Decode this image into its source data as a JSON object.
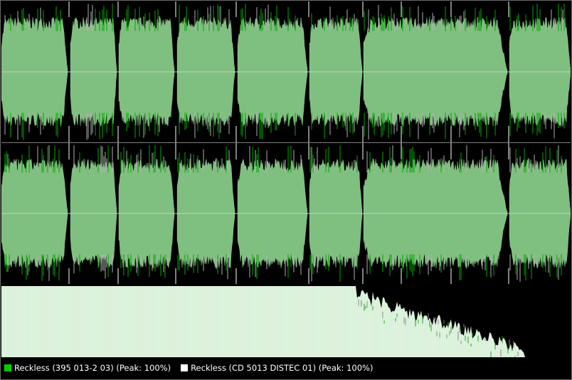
{
  "legend": {
    "items": [
      {
        "label": "Reckless (395 013-2 03) (Peak: 100%)",
        "color": "#00cc00"
      },
      {
        "label": "Reckless (CD 5013 DISTEC 01) (Peak: 100%)",
        "color": "#ffffff"
      }
    ]
  },
  "colors": {
    "background": "#000000",
    "wave_fill": "#7fbf7f",
    "wave_peak_a": "#00a800",
    "wave_peak_b": "#b0b0b0",
    "center_line": "#b8d8b8",
    "separator": "#808080",
    "spectrum_fill": "#d8f0d8",
    "border": "#6a6a6a"
  }
}
